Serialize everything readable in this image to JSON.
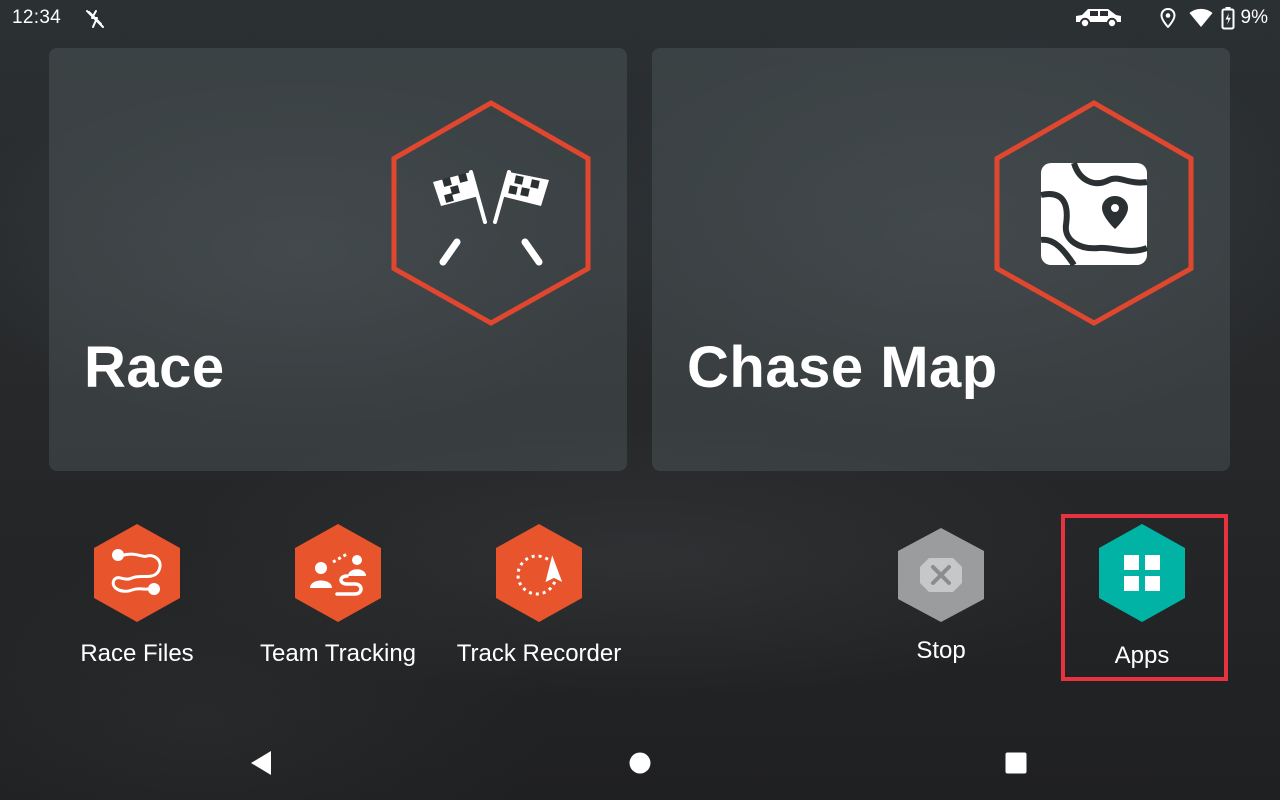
{
  "status_bar": {
    "time": "12:34",
    "battery_pct": "9%",
    "icons": [
      "no-sync-icon",
      "vehicle-icon",
      "location-pin-icon",
      "wifi-icon",
      "battery-charging-icon"
    ]
  },
  "tiles": {
    "race": {
      "title": "Race",
      "icon": "checkered-flags-icon"
    },
    "chase_map": {
      "title": "Chase Map",
      "icon": "map-pin-icon"
    }
  },
  "shortcuts": {
    "race_files": {
      "label": "Race Files",
      "icon": "route-icon"
    },
    "team_tracking": {
      "label": "Team Tracking",
      "icon": "team-tracking-icon"
    },
    "track_recorder": {
      "label": "Track Recorder",
      "icon": "track-recorder-icon"
    },
    "stop": {
      "label": "Stop",
      "icon": "stop-x-icon"
    },
    "apps": {
      "label": "Apps",
      "icon": "apps-grid-icon"
    }
  },
  "navigation": {
    "buttons": [
      "back-icon",
      "home-icon",
      "recents-icon"
    ]
  },
  "colors": {
    "accent_orange": "#e8542c",
    "hex_outline_red": "#e0472e",
    "apps_teal": "#00b3a4",
    "stop_gray": "#9a9c9e",
    "highlight_red": "#e8323f"
  }
}
